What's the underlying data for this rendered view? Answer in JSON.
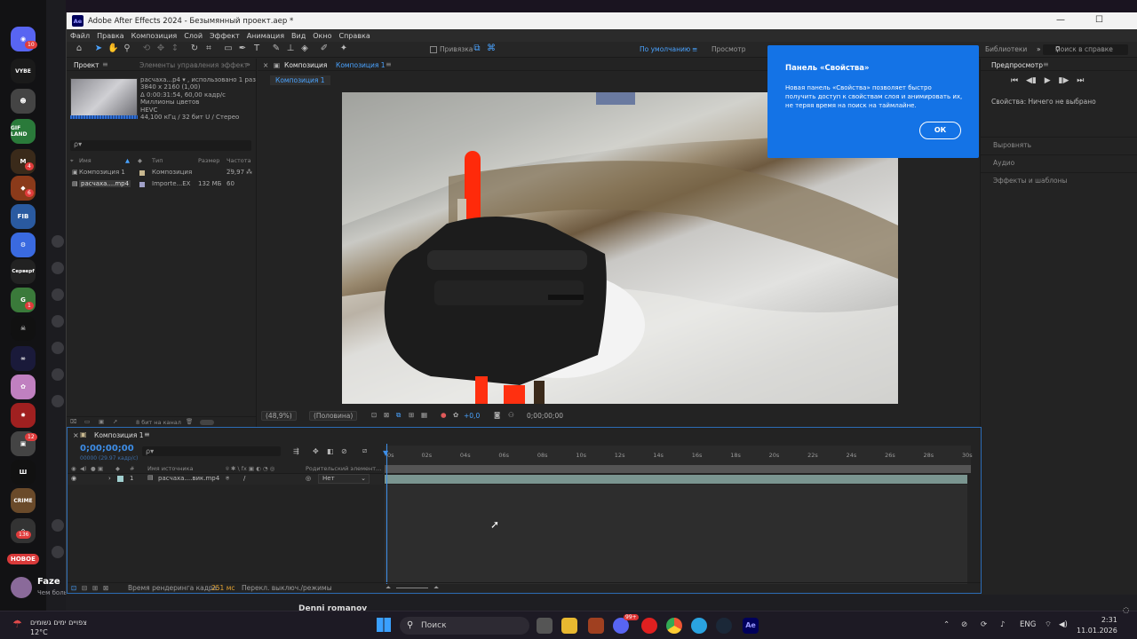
{
  "sidebar": {
    "badges": [
      "10",
      "4",
      "6",
      "1",
      "12",
      "136"
    ],
    "labels": [
      "VYBE",
      "GIF LAND",
      "FIB",
      "Серверf"
    ],
    "new_badge": "НОВОЕ",
    "user": "Faze",
    "message": "Чем больше девушку мы любим, тем о…"
  },
  "window": {
    "app_title": "Adobe After Effects 2024 - Безымянный проект.aep *",
    "logo": "Ae"
  },
  "menu": [
    "Файл",
    "Правка",
    "Композиция",
    "Слой",
    "Эффект",
    "Анимация",
    "Вид",
    "Окно",
    "Справка"
  ],
  "toolbar": {
    "snap_label": "Привязка",
    "workspace_default": "По умолчанию",
    "workspace_review": "Просмотр",
    "libraries": "Библиотеки",
    "search_help": "Поиск в справке"
  },
  "project": {
    "tab_project": "Проект",
    "tab_effects": "Элементы управления эффект",
    "info_lines": [
      "расчаха...р4 ▾ , использовано 1 раз",
      "3840 x 2160 (1,00)",
      "Δ 0:00:31:54, 60,00 кадр/с",
      "Миллионы цветов",
      "HEVC",
      "44,100 кГц / 32 бит U / Стерео"
    ],
    "search_placeholder": "ρ▾",
    "columns": [
      "Имя",
      "Тип",
      "Размер",
      "Частота ..."
    ],
    "rows": [
      {
        "name": "Композиция 1",
        "type": "Композиция",
        "size": "",
        "rate": "29,97"
      },
      {
        "name": "расчаха....mp4",
        "type": "Importe...EX",
        "size": "132 МБ",
        "rate": "60"
      }
    ],
    "bits": "8 бит на канал"
  },
  "composition": {
    "tab_label": "Композиция",
    "tab_name": "Композиция 1",
    "subtab": "Композиция 1",
    "zoom": "(48,9%)",
    "resolution": "(Половина)",
    "exposure": "+0,0",
    "timecode": "0;00;00;00"
  },
  "right_panel": {
    "preview": "Предпросмотр",
    "properties": "Свойства: Ничего не выбрано",
    "sections": [
      "Выровнять",
      "Аудио",
      "Эффекты и шаблоны"
    ]
  },
  "popup": {
    "title": "Панель «Свойства»",
    "body": "Новая панель «Свойства» позволяет быстро получить доступ к свойствам слоя и анимировать их, не теряя время на поиск на таймлайне.",
    "ok": "ОК"
  },
  "timeline": {
    "tab": "Композиция 1",
    "timecode": "0;00;00;00",
    "timecode_sub": "00000 (29.97 кадр/с)",
    "col_source": "Имя источника",
    "col_parent": "Родительский элемент...",
    "layer_index": "1",
    "layer_name": "расчаха....вик.mp4",
    "parent_value": "Нет",
    "ticks": [
      "0s",
      "02s",
      "04s",
      "06s",
      "08s",
      "10s",
      "12s",
      "14s",
      "16s",
      "18s",
      "20s",
      "22s",
      "24s",
      "26s",
      "28s",
      "30s"
    ],
    "render_label": "Время рендеринга кадра:",
    "render_value": "251 мс",
    "modes": "Перекл. выключ./режимы"
  },
  "below": {
    "user": "Denni romanov"
  },
  "taskbar": {
    "weather_line1": "צפויים ימים גשומים",
    "weather_line2": "12°C",
    "search": "Поиск",
    "lang": "ENG",
    "time": "2:31",
    "date": "11.01.2026",
    "app_badge": "99+"
  },
  "colors": {
    "accent_blue": "#1473e6",
    "timecode_blue": "#3d8ee8",
    "layer_bar": "#7a9590",
    "discord_red": "#e03c3c"
  }
}
